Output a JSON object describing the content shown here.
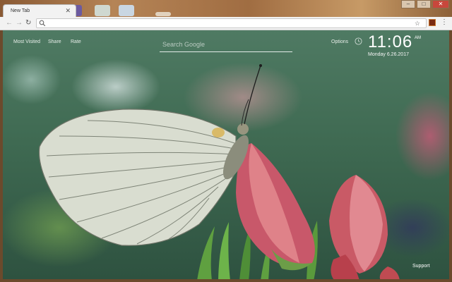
{
  "browser": {
    "tab": {
      "title": "New Tab",
      "close_glyph": "✕"
    },
    "window_controls": {
      "minimize": "–",
      "maximize": "□",
      "close": "✕"
    },
    "toolbar": {
      "back": "←",
      "forward": "→",
      "reload": "↻",
      "url": "",
      "bookmark_glyph": "☆",
      "menu_glyph": "⋮"
    }
  },
  "page": {
    "links": {
      "most_visited": "Most Visited",
      "share": "Share",
      "rate": "Rate"
    },
    "search": {
      "placeholder": "Search Google",
      "value": ""
    },
    "options": "Options",
    "clock": {
      "time": "11:06",
      "ampm": "AM",
      "date": "Monday  6.26.2017"
    },
    "support": "Support"
  }
}
